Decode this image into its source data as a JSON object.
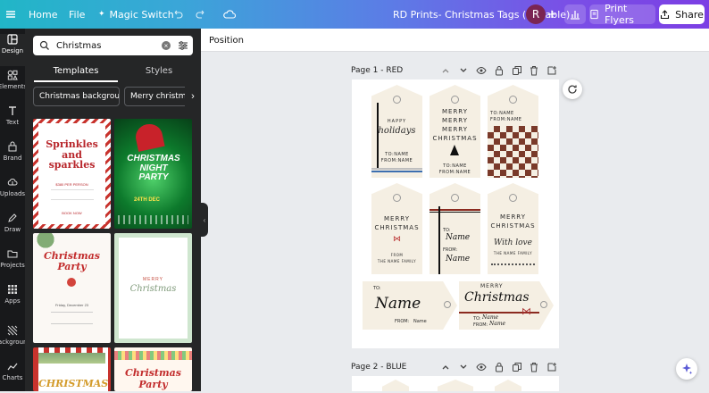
{
  "topbar": {
    "home": "Home",
    "file": "File",
    "magic_switch": "Magic Switch",
    "doc_title": "RD Prints- Christmas Tags (Editable)",
    "avatar_initial": "R",
    "print_flyers": "Print Flyers",
    "share": "Share"
  },
  "rail": {
    "items": [
      {
        "label": "Design",
        "icon": "design-icon"
      },
      {
        "label": "Elements",
        "icon": "elements-icon"
      },
      {
        "label": "Text",
        "icon": "text-icon"
      },
      {
        "label": "Brand",
        "icon": "brand-icon"
      },
      {
        "label": "Uploads",
        "icon": "uploads-icon"
      },
      {
        "label": "Draw",
        "icon": "draw-icon"
      },
      {
        "label": "Projects",
        "icon": "projects-icon"
      },
      {
        "label": "Apps",
        "icon": "apps-icon"
      },
      {
        "label": "Background",
        "icon": "background-icon"
      },
      {
        "label": "Charts",
        "icon": "charts-icon"
      }
    ]
  },
  "panel": {
    "search_value": "Christmas",
    "tabs": [
      "Templates",
      "Styles"
    ],
    "chips": [
      "Christmas background",
      "Merry christmas"
    ],
    "templates": [
      {
        "title": "Sprinkles and sparkles",
        "kicker": "",
        "detail": "$380 PER PERSON",
        "note": "BOOK NOW"
      },
      {
        "title": "CHRISTMAS NIGHT PARTY",
        "kicker": "24TH DEC",
        "detail": "",
        "note": ""
      },
      {
        "title": "Christmas Party",
        "kicker": "",
        "detail": "Friday, December 23",
        "note": ""
      },
      {
        "title": "Christmas",
        "kicker": "MERRY",
        "detail": "",
        "note": ""
      },
      {
        "title": "CHRISTMAS",
        "kicker": "",
        "detail": "",
        "note": ""
      },
      {
        "title": "Christmas Party",
        "kicker": "",
        "detail": "",
        "note": ""
      }
    ]
  },
  "context": {
    "position": "Position"
  },
  "pages": [
    {
      "label": "Page 1 - RED"
    },
    {
      "label": "Page 2 - BLUE"
    }
  ],
  "tags": {
    "happy": "HAPPY",
    "holidays": "holidays",
    "to_name": "TO:NAME",
    "from_name": "FROM:NAME",
    "merry": "MERRY",
    "christmas": "CHRISTMAS",
    "to": "TO:",
    "from": "FROM:",
    "from_word": "FROM",
    "name_script": "Name",
    "the_name_family": "THE NAME FAMILY",
    "with_love": "With love",
    "merry_script": "Christmas",
    "name_small": "Name"
  },
  "colors": {
    "accent": "#7b3fe4",
    "check": "#7a3a2a",
    "tag_bg": "#f5efe3",
    "red_stripe": "#8b2a1f"
  }
}
